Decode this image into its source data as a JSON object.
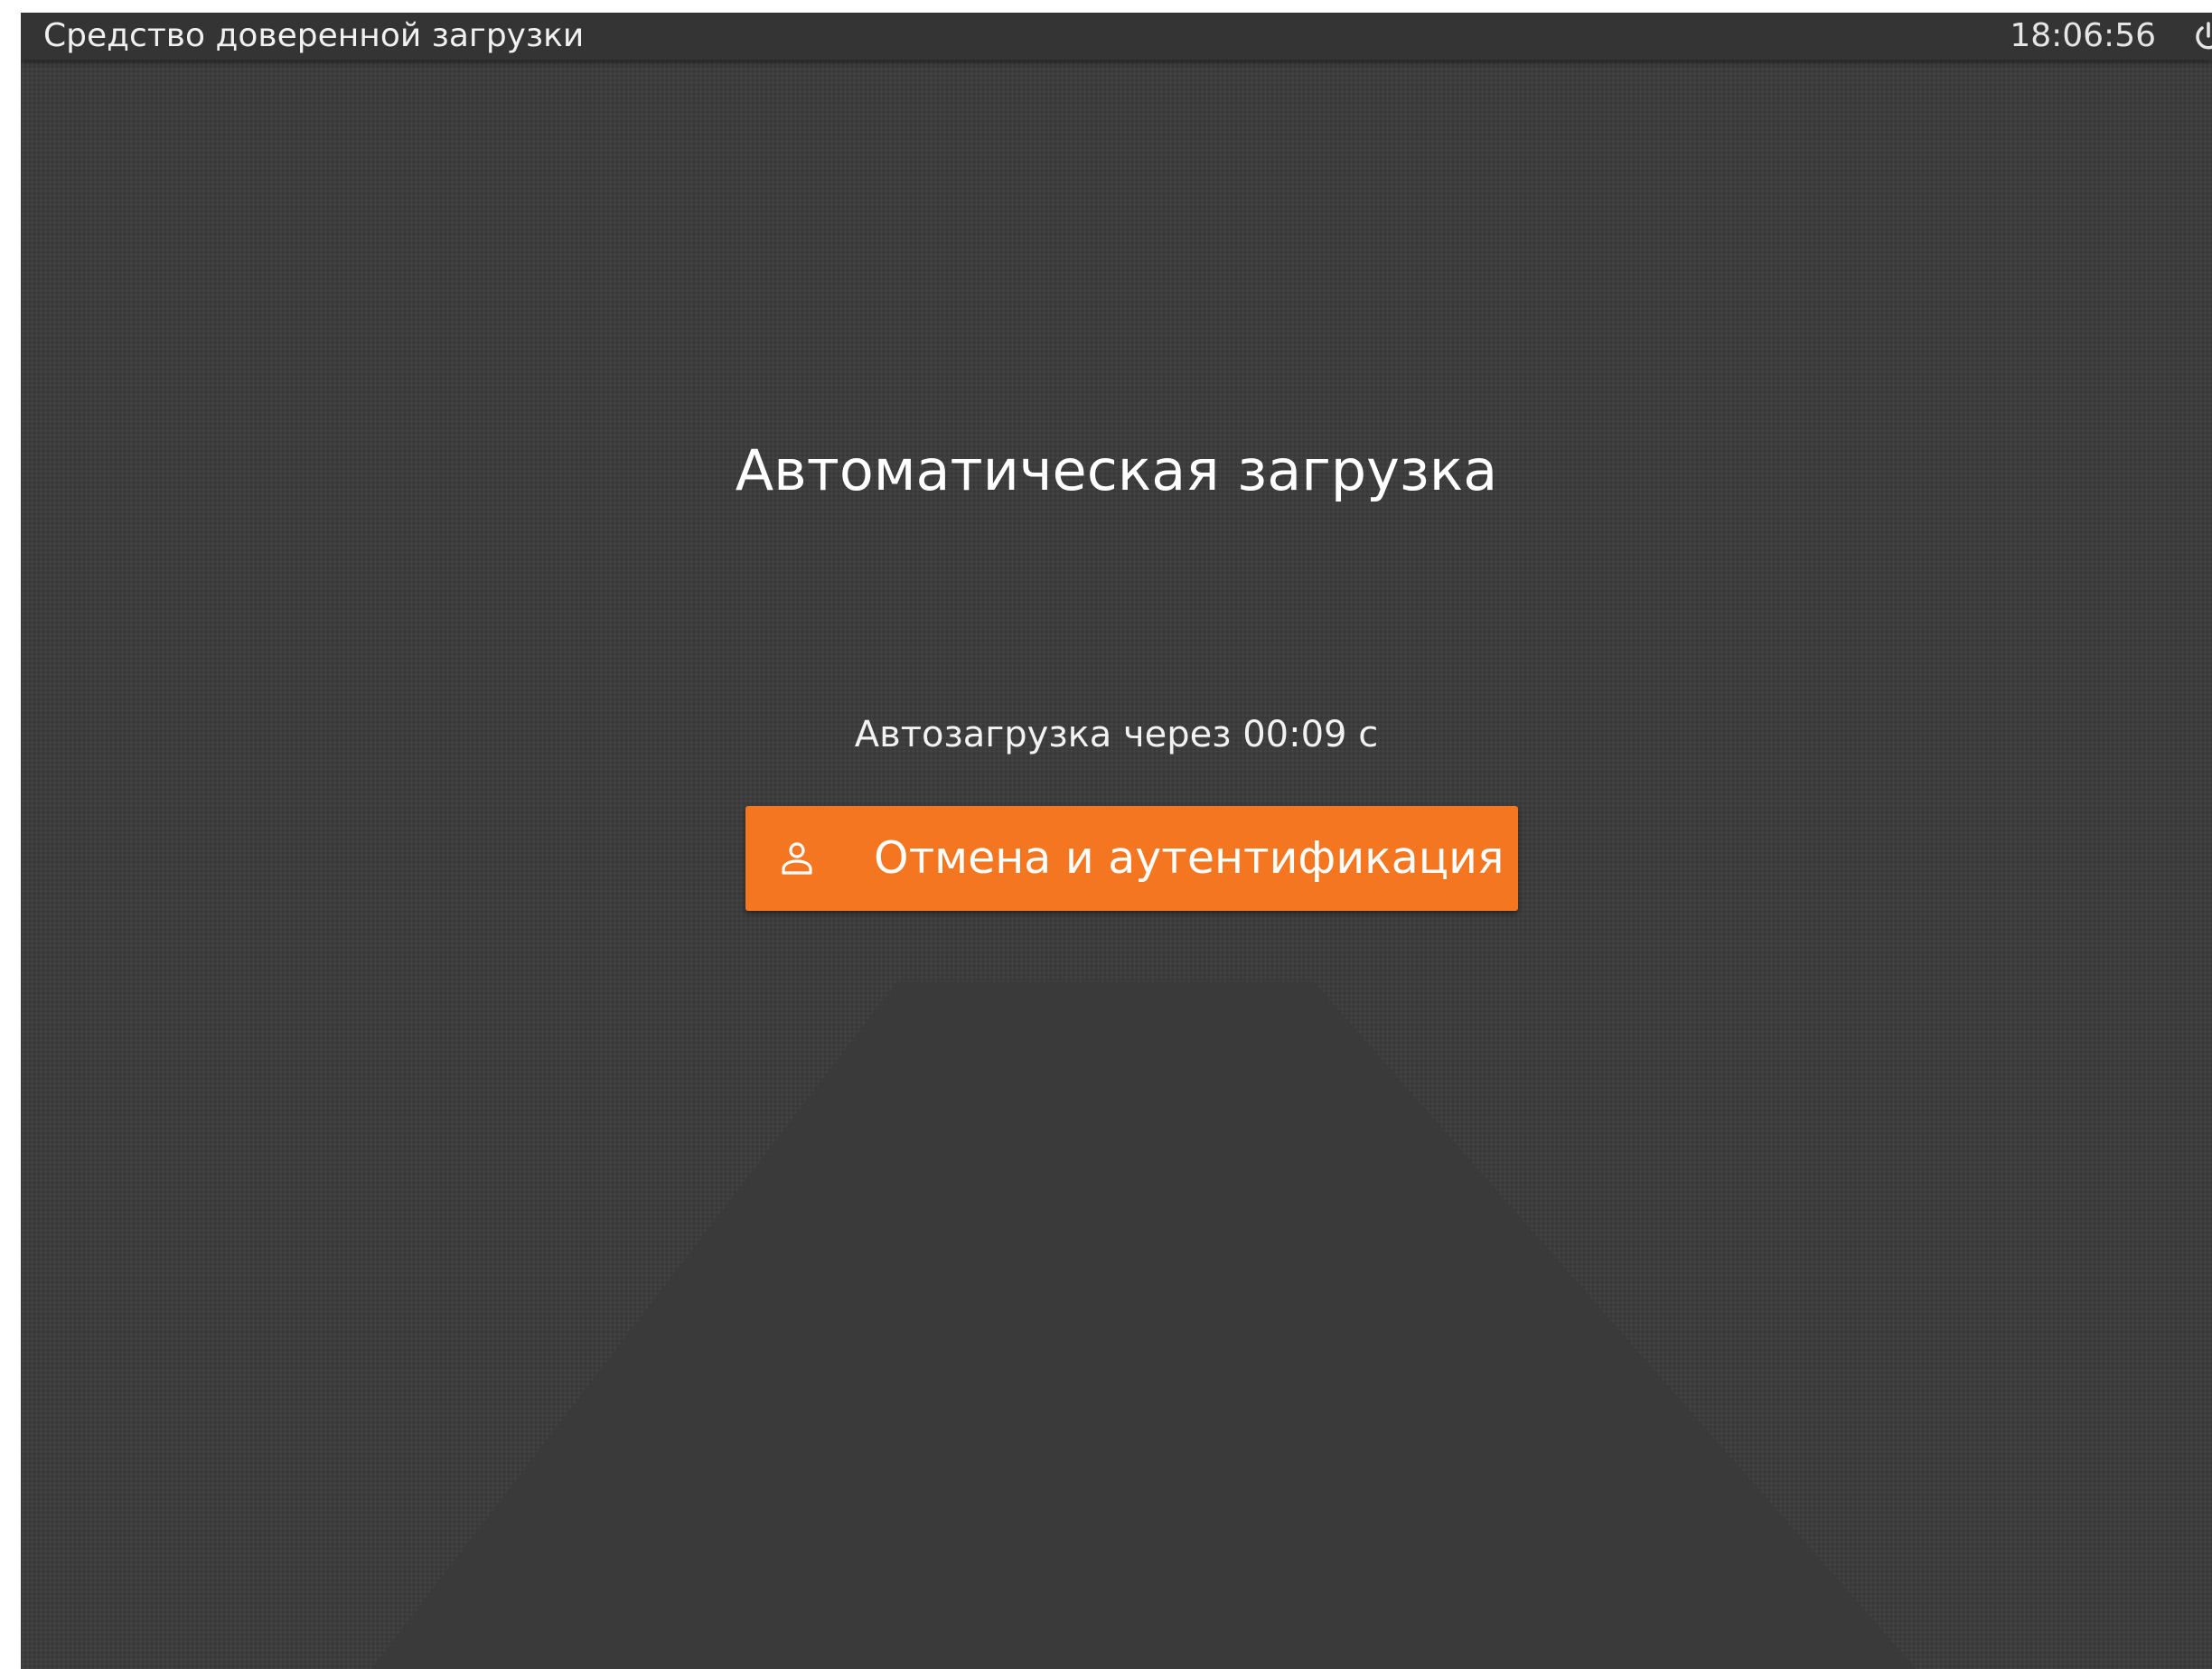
{
  "topbar": {
    "app_title": "Средство доверенной загрузки",
    "clock": "18:06:56",
    "power_icon": "power-icon"
  },
  "main": {
    "title": "Автоматическая загрузка",
    "countdown": "Автозагрузка через 00:09 с",
    "cancel_button": {
      "label": "Отмена и аутентификация",
      "icon": "user-icon"
    }
  },
  "colors": {
    "background": "#3d3d3d",
    "topbar": "#343434",
    "accent": "#f47621",
    "text": "#ffffff"
  }
}
